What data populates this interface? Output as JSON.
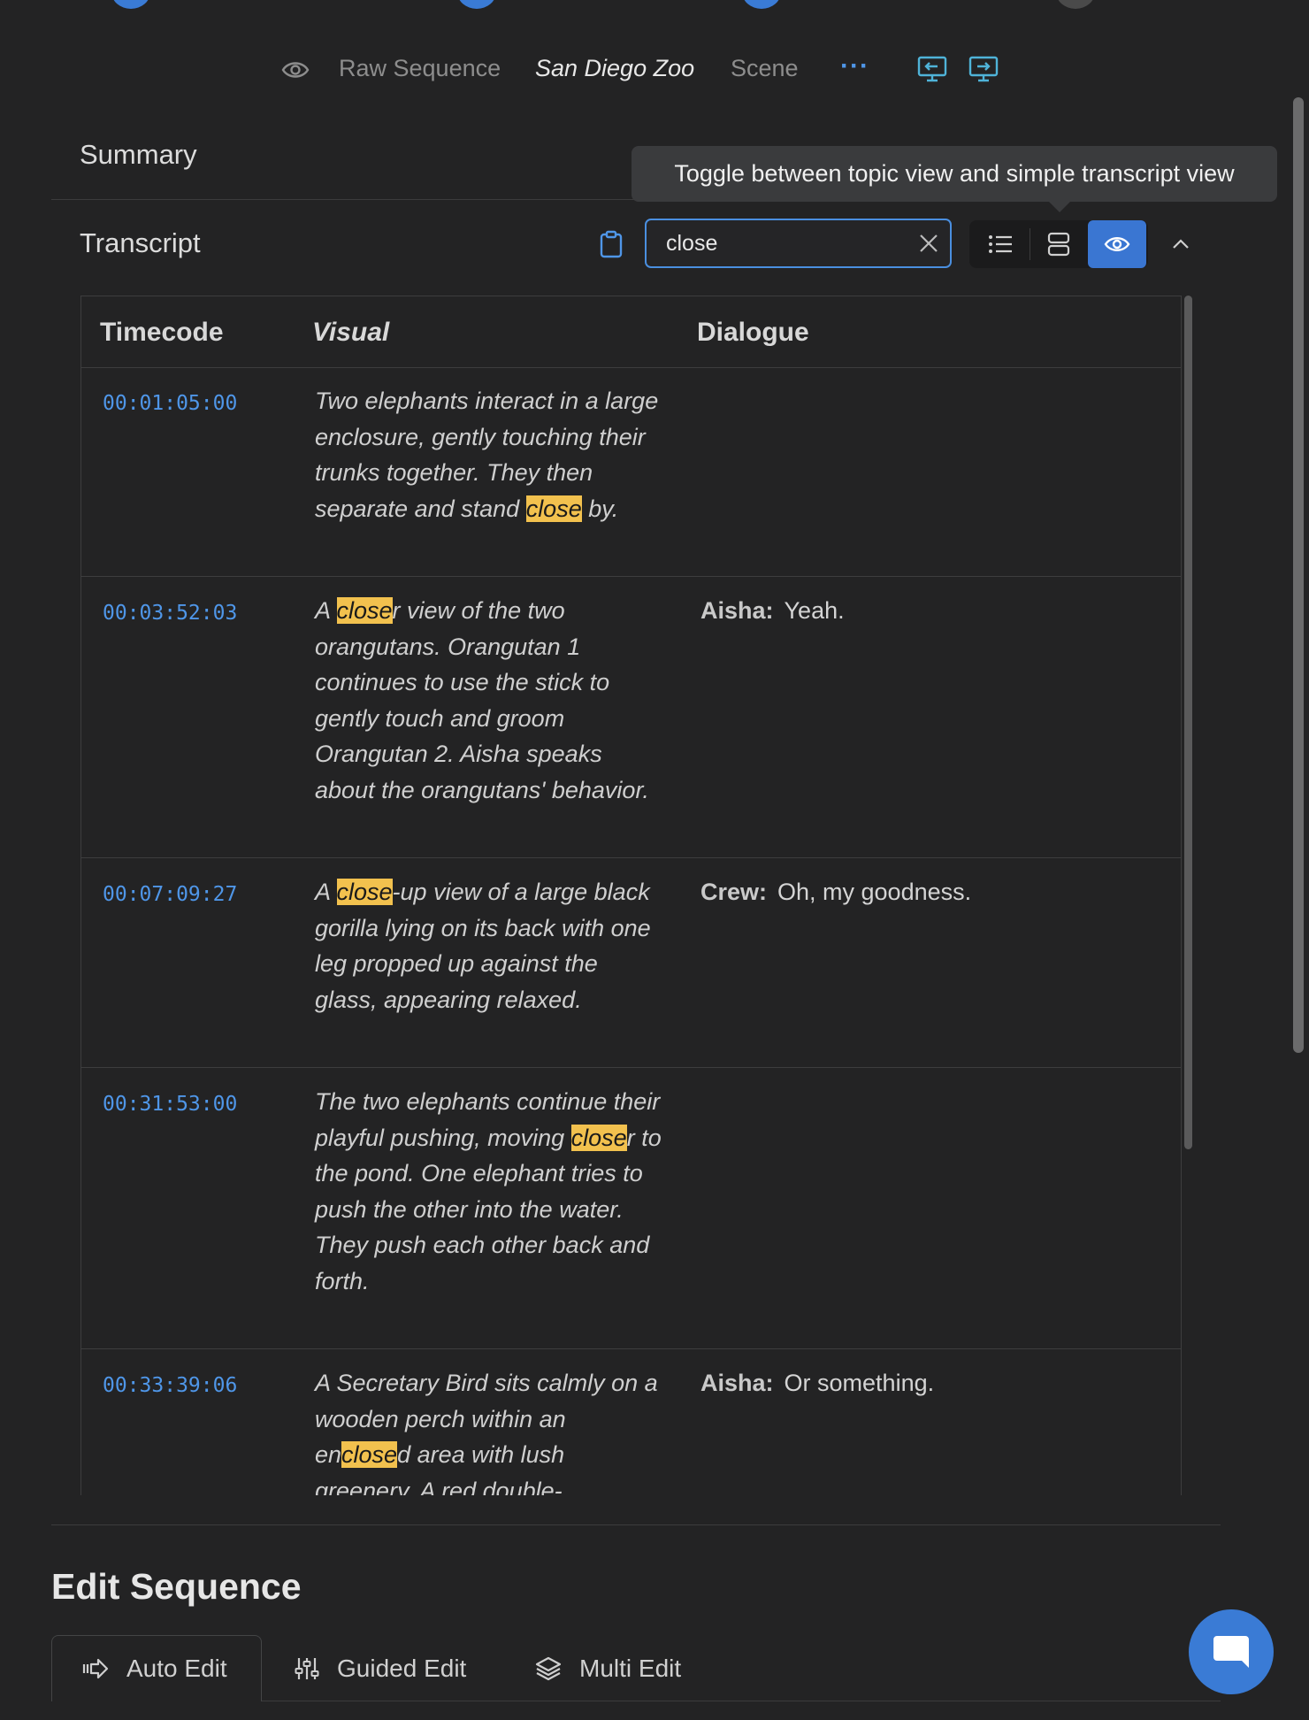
{
  "breadcrumb": {
    "items": [
      "Raw Sequence",
      "San Diego Zoo",
      "Scene"
    ],
    "more": "···"
  },
  "summary": {
    "label": "Summary"
  },
  "transcript": {
    "label": "Transcript",
    "tooltip": "Toggle between topic view and simple transcript view",
    "search_value": "close",
    "columns": [
      "Timecode",
      "Visual",
      "Dialogue"
    ],
    "rows": [
      {
        "timecode": "00:01:05:00",
        "visual": [
          "Two elephants interact in a large enclosure, gently touching their trunks together. They then separate and stand ",
          "close",
          " by."
        ],
        "speaker": "",
        "dialogue": ""
      },
      {
        "timecode": "00:03:52:03",
        "visual": [
          "A ",
          "close",
          "r view of the two orangutans. Orangutan 1 continues to use the stick to gently touch and groom Orangutan 2. Aisha speaks about the orangutans' behavior."
        ],
        "speaker": "Aisha:",
        "dialogue": "Yeah."
      },
      {
        "timecode": "00:07:09:27",
        "visual": [
          "A ",
          "close",
          "-up view of a large black gorilla lying on its back with one leg propped up against the glass, appearing relaxed."
        ],
        "speaker": "Crew:",
        "dialogue": "Oh, my goodness."
      },
      {
        "timecode": "00:31:53:00",
        "visual": [
          "The two elephants continue their playful pushing, moving ",
          "close",
          "r to the pond. One elephant tries to push the other into the water. They push each other back and forth."
        ],
        "speaker": "",
        "dialogue": ""
      },
      {
        "timecode": "00:33:39:06",
        "visual": [
          "A Secretary Bird sits calmly on a wooden perch within an en",
          "close",
          "d area with lush greenery. A red double-"
        ],
        "speaker": "Aisha:",
        "dialogue": "Or something."
      }
    ]
  },
  "edit_sequence": {
    "title": "Edit Sequence",
    "tabs": [
      "Auto Edit",
      "Guided Edit",
      "Multi Edit"
    ]
  },
  "colors": {
    "accent": "#3a7bd5",
    "highlight": "#f2c14e",
    "timecode": "#4f96e8"
  }
}
